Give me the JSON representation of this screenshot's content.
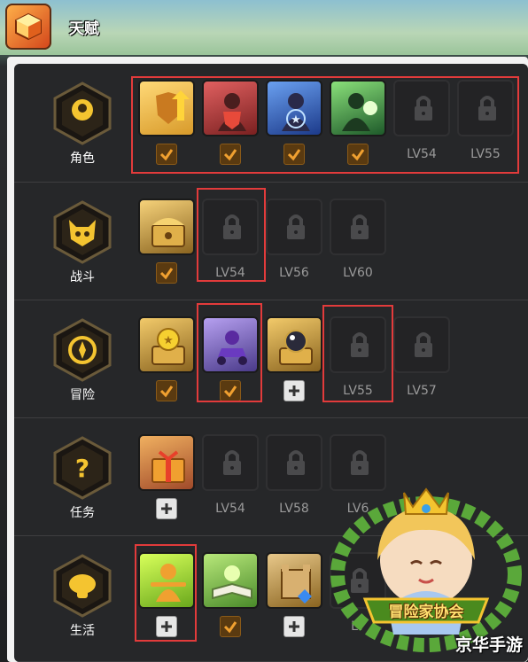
{
  "window": {
    "title": "天赋",
    "icon": "talent-cube-icon"
  },
  "colors": {
    "accent": "#e8a63c",
    "check": "#f0a030",
    "highlight": "#e23b3b",
    "panel": "#262729"
  },
  "rows": [
    {
      "label": "角色",
      "icon": "role-icon",
      "slots": [
        {
          "icon": "shield-up-icon",
          "state": "learned",
          "mark": "check"
        },
        {
          "icon": "shield-red-icon",
          "state": "learned",
          "mark": "check"
        },
        {
          "icon": "star-aura-icon",
          "state": "learned",
          "mark": "check"
        },
        {
          "icon": "green-burst-icon",
          "state": "learned",
          "mark": "check"
        },
        {
          "icon": "lock-icon",
          "state": "locked",
          "level": "LV54"
        },
        {
          "icon": "lock-icon",
          "state": "locked",
          "level": "LV55"
        }
      ]
    },
    {
      "label": "战斗",
      "icon": "battle-icon",
      "slots": [
        {
          "icon": "chest-gold-icon",
          "state": "learned",
          "mark": "check"
        },
        {
          "icon": "lock-icon",
          "state": "locked",
          "level": "LV54"
        },
        {
          "icon": "lock-icon",
          "state": "locked",
          "level": "LV56"
        },
        {
          "icon": "lock-icon",
          "state": "locked",
          "level": "LV60"
        }
      ]
    },
    {
      "label": "冒险",
      "icon": "compass-icon",
      "slots": [
        {
          "icon": "coin-chest-icon",
          "state": "learned",
          "mark": "check"
        },
        {
          "icon": "kart-icon",
          "state": "learned",
          "mark": "check"
        },
        {
          "icon": "orb-chest-icon",
          "state": "available",
          "mark": "plus"
        },
        {
          "icon": "lock-icon",
          "state": "locked",
          "level": "LV55"
        },
        {
          "icon": "lock-icon",
          "state": "locked",
          "level": "LV57"
        }
      ]
    },
    {
      "label": "任务",
      "icon": "question-icon",
      "slots": [
        {
          "icon": "gift-box-icon",
          "state": "available",
          "mark": "plus"
        },
        {
          "icon": "lock-icon",
          "state": "locked",
          "level": "LV54"
        },
        {
          "icon": "lock-icon",
          "state": "locked",
          "level": "LV58"
        },
        {
          "icon": "lock-icon",
          "state": "locked",
          "level": "LV6"
        }
      ]
    },
    {
      "label": "生活",
      "icon": "life-icon",
      "slots": [
        {
          "icon": "figure-green-icon",
          "state": "available",
          "mark": "plus"
        },
        {
          "icon": "book-icon",
          "state": "learned",
          "mark": "check"
        },
        {
          "icon": "castle-gem-icon",
          "state": "available",
          "mark": "plus"
        },
        {
          "icon": "lock-icon",
          "state": "locked",
          "level": "LV"
        }
      ]
    }
  ],
  "logo": {
    "banner": "冒险家协会",
    "icon": "adventurer-guild-logo"
  },
  "watermark": "京华手游"
}
